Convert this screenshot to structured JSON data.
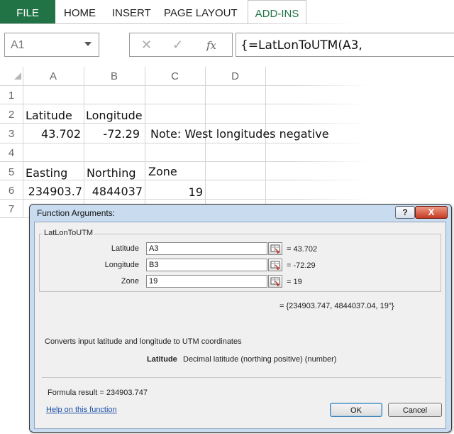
{
  "ribbon": {
    "tabs": [
      {
        "label": "FILE"
      },
      {
        "label": "HOME"
      },
      {
        "label": "INSERT"
      },
      {
        "label": "PAGE LAYOUT"
      },
      {
        "label": "ADD-INS"
      }
    ],
    "file_bg": "#217346"
  },
  "formula_bar": {
    "name_box": "A1",
    "cancel_glyph": "✕",
    "enter_glyph": "✓",
    "fx_glyph": "fx",
    "formula": "{=LatLonToUTM(A3,"
  },
  "grid": {
    "columns": [
      "A",
      "B",
      "C",
      "D"
    ],
    "rows": [
      "1",
      "2",
      "3",
      "4",
      "5",
      "6",
      "7"
    ],
    "cells": {
      "a2": "Latitude",
      "b2": "Longitude",
      "a3": "43.702",
      "b3": "-72.29",
      "c3": "Note: West longitudes negative",
      "a5": "Easting",
      "b5": "Northing",
      "c5": "Zone",
      "a6": "234903.7",
      "b6": "4844037",
      "c6": "19"
    }
  },
  "dialog": {
    "title": "Function Arguments:",
    "help_glyph": "?",
    "close_glyph": "X",
    "function_name": "LatLonToUTM",
    "args": [
      {
        "label": "Latitude",
        "value": "A3",
        "eval": "= 43.702"
      },
      {
        "label": "Longitude",
        "value": "B3",
        "eval": "= -72.29"
      },
      {
        "label": "Zone",
        "value": "19",
        "eval": "= 19"
      }
    ],
    "result": "= {234903.747, 4844037.04, 19\"}",
    "description": "Converts input latitude and longitude to UTM coordinates",
    "arg_desc_name": "Latitude",
    "arg_desc_text": "Decimal latitude (northing positive) (number)",
    "formula_result": "Formula result = 234903.747",
    "help_link": "Help on this function",
    "ok_label": "OK",
    "cancel_label": "Cancel"
  }
}
